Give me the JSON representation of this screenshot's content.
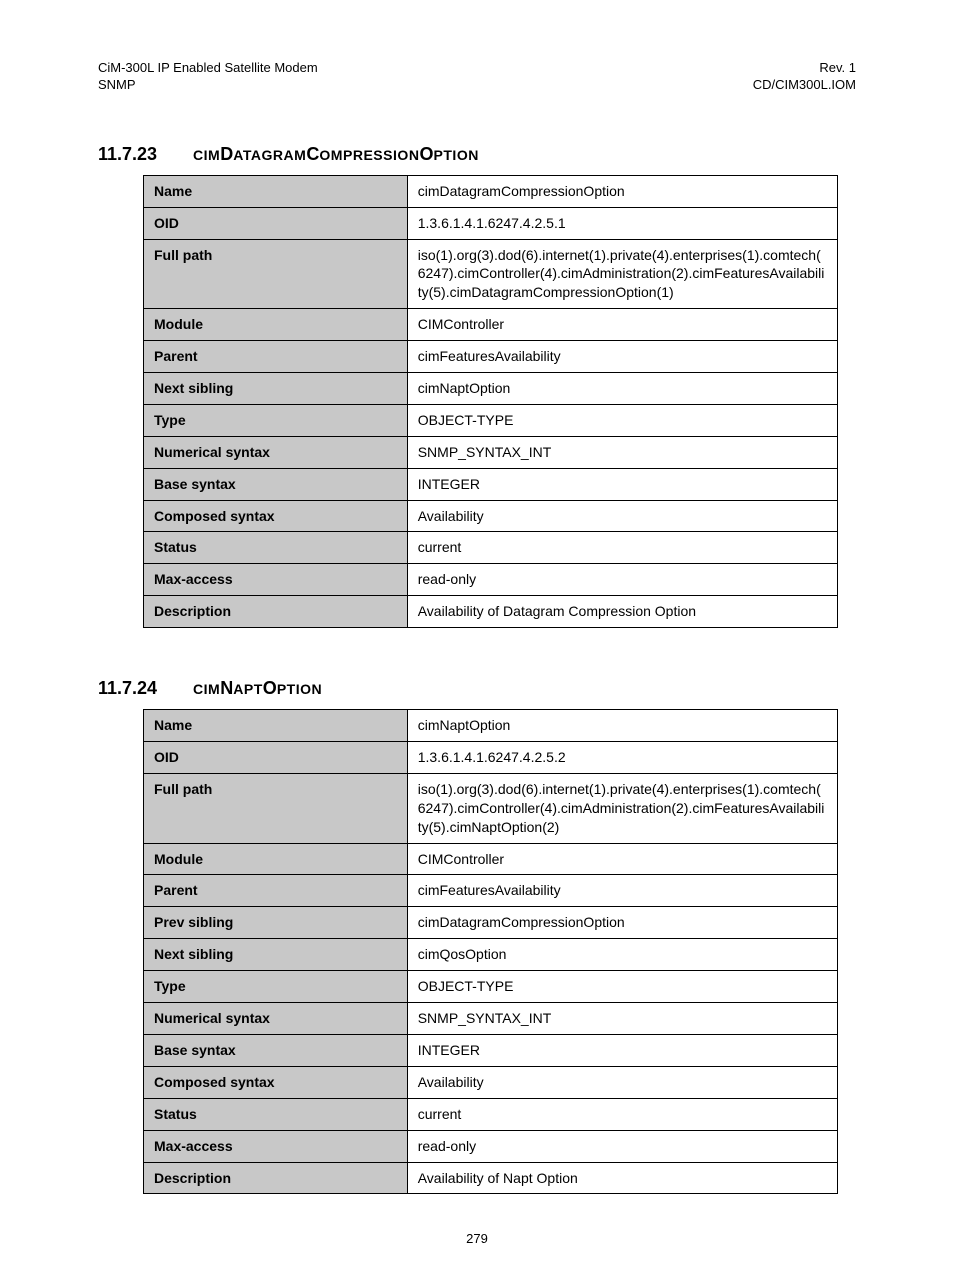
{
  "header": {
    "left_line1": "CiM-300L IP Enabled Satellite Modem",
    "left_line2": "SNMP",
    "right_line1": "Rev. 1",
    "right_line2": "CD/CIM300L.IOM"
  },
  "page_number": "279",
  "sections": [
    {
      "number": "11.7.23",
      "title_parts": [
        "cim",
        "D",
        "atagram",
        "C",
        "ompression",
        "O",
        "ption"
      ],
      "rows": [
        {
          "label": "Name",
          "value": "cimDatagramCompressionOption"
        },
        {
          "label": "OID",
          "value": "1.3.6.1.4.1.6247.4.2.5.1"
        },
        {
          "label": "Full path",
          "value": "iso(1).org(3).dod(6).internet(1).private(4).enterprises(1).comtech(6247).cimController(4).cimAdministration(2).cimFeaturesAvailability(5).cimDatagramCompressionOption(1)"
        },
        {
          "label": "Module",
          "value": "CIMController"
        },
        {
          "label": "Parent",
          "value": "cimFeaturesAvailability"
        },
        {
          "label": "Next sibling",
          "value": "cimNaptOption"
        },
        {
          "label": "Type",
          "value": "OBJECT-TYPE"
        },
        {
          "label": "Numerical syntax",
          "value": "SNMP_SYNTAX_INT"
        },
        {
          "label": "Base syntax",
          "value": "INTEGER"
        },
        {
          "label": "Composed syntax",
          "value": "Availability"
        },
        {
          "label": "Status",
          "value": "current"
        },
        {
          "label": "Max-access",
          "value": "read-only"
        },
        {
          "label": "Description",
          "value": "Availability of Datagram Compression Option"
        }
      ]
    },
    {
      "number": "11.7.24",
      "title_parts": [
        "cim",
        "N",
        "apt",
        "O",
        "ption"
      ],
      "rows": [
        {
          "label": "Name",
          "value": "cimNaptOption"
        },
        {
          "label": "OID",
          "value": "1.3.6.1.4.1.6247.4.2.5.2"
        },
        {
          "label": "Full path",
          "value": "iso(1).org(3).dod(6).internet(1).private(4).enterprises(1).comtech(6247).cimController(4).cimAdministration(2).cimFeaturesAvailability(5).cimNaptOption(2)"
        },
        {
          "label": "Module",
          "value": "CIMController"
        },
        {
          "label": "Parent",
          "value": "cimFeaturesAvailability"
        },
        {
          "label": "Prev sibling",
          "value": "cimDatagramCompressionOption"
        },
        {
          "label": "Next sibling",
          "value": "cimQosOption"
        },
        {
          "label": "Type",
          "value": "OBJECT-TYPE"
        },
        {
          "label": "Numerical syntax",
          "value": "SNMP_SYNTAX_INT"
        },
        {
          "label": "Base syntax",
          "value": "INTEGER"
        },
        {
          "label": "Composed syntax",
          "value": "Availability"
        },
        {
          "label": "Status",
          "value": "current"
        },
        {
          "label": "Max-access",
          "value": "read-only"
        },
        {
          "label": "Description",
          "value": "Availability of Napt Option"
        }
      ]
    }
  ]
}
